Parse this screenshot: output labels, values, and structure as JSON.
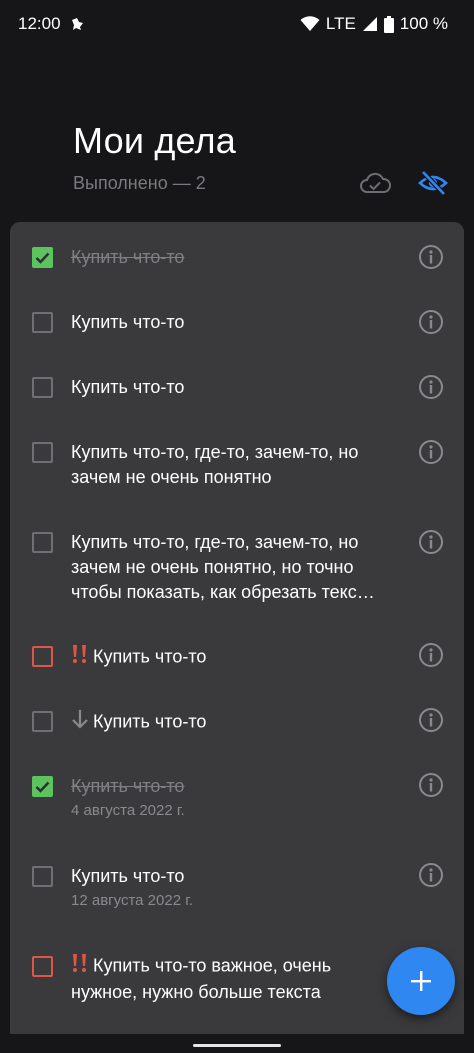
{
  "status_bar": {
    "time": "12:00",
    "network": "LTE",
    "battery": "100 %"
  },
  "header": {
    "title": "Мои дела",
    "done_counter": "Выполнено — 2",
    "cloud_icon": "cloud-check-icon",
    "visibility_icon": "eye-off-icon",
    "accent_color": "#2f87f2"
  },
  "tasks": [
    {
      "text": "Купить что-то",
      "done": true,
      "priority": "none",
      "date": ""
    },
    {
      "text": "Купить что-то",
      "done": false,
      "priority": "none",
      "date": ""
    },
    {
      "text": "Купить что-то",
      "done": false,
      "priority": "none",
      "date": ""
    },
    {
      "text": "Купить что-то, где-то, зачем-то, но зачем не очень понятно",
      "done": false,
      "priority": "none",
      "date": ""
    },
    {
      "text": "Купить что-то, где-то, зачем-то, но зачем не очень понятно, но точно чтобы показать, как обрезать текс…",
      "done": false,
      "priority": "none",
      "date": ""
    },
    {
      "text": "Купить что-то",
      "done": false,
      "priority": "high",
      "date": ""
    },
    {
      "text": "Купить что-то",
      "done": false,
      "priority": "low",
      "date": ""
    },
    {
      "text": "Купить что-то",
      "done": true,
      "priority": "none",
      "date": "4 августа 2022 г."
    },
    {
      "text": "Купить что-то",
      "done": false,
      "priority": "none",
      "date": "12 августа 2022 г."
    },
    {
      "text": "Купить что-то важное, очень нужное, нужно больше текста",
      "done": false,
      "priority": "high",
      "date": ""
    }
  ],
  "colors": {
    "done_check": "#5cc35f",
    "important_border": "#e05547",
    "card_bg": "#3a3a3c"
  },
  "fab": {
    "label": "+",
    "icon": "plus-icon"
  }
}
